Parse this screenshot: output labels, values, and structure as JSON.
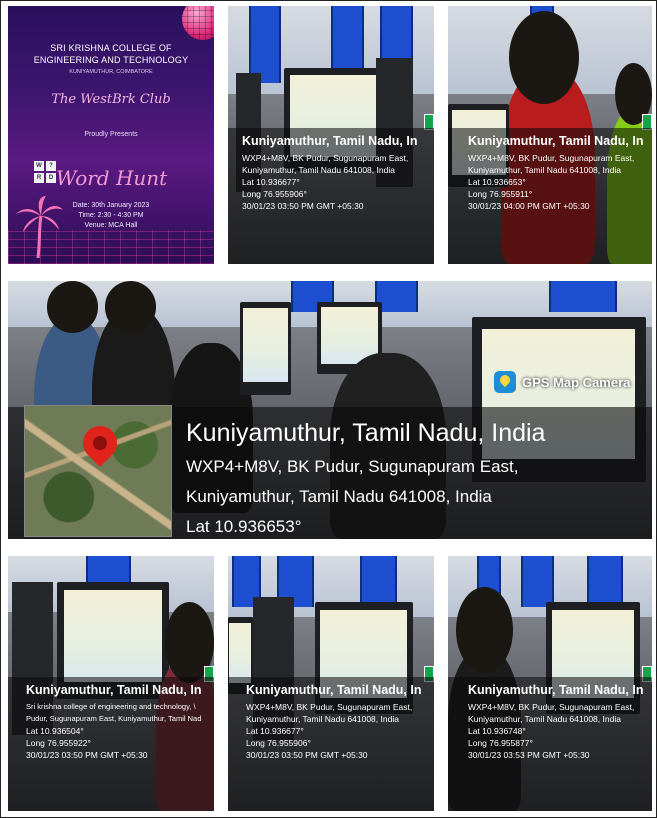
{
  "poster": {
    "college_line1": "SRI KRISHNA COLLEGE OF",
    "college_line2": "ENGINEERING AND TECHNOLOGY",
    "place": "KUNIYAMUTHUR, COIMBATORE",
    "club": "The WestBrk Club",
    "presents": "Proudly Presents",
    "event": "Word Hunt",
    "date": "Date: 30th January 2023",
    "time": "Time: 2:30 - 4:30 PM",
    "venue": "Venue: MCA Hall",
    "grid_letters": [
      "W",
      "?",
      "R",
      "D"
    ]
  },
  "photos": [
    {
      "title": "Kuniyamuthur, Tamil Nadu, In",
      "line1": "WXP4+M8V, BK Pudur, Sugunapuram East,",
      "line2": "Kuniyamuthur, Tamil Nadu 641008, India",
      "lat": "Lat 10.936677°",
      "long": "Long 76.955906°",
      "time": "30/01/23 03:50 PM GMT +05:30"
    },
    {
      "title": "Kuniyamuthur, Tamil Nadu, In",
      "line1": "WXP4+M8V, BK Pudur, Sugunapuram East,",
      "line2": "Kuniyamuthur, Tamil Nadu 641008, India",
      "lat": "Lat 10.936653°",
      "long": "Long 76.955911°",
      "time": "30/01/23 04:00 PM GMT +05:30"
    },
    {
      "title": "Kuniyamuthur, Tamil Nadu, In",
      "line1": "Sri krishna college of engineering and technology, \\",
      "line2": "Pudur, Sugunapuram East, Kuniyamuthur, Tamil Nad",
      "lat": "Lat 10.936504°",
      "long": "Long 76.955922°",
      "time": "30/01/23 03:50 PM GMT +05:30"
    },
    {
      "title": "Kuniyamuthur, Tamil Nadu, In",
      "line1": "WXP4+M8V, BK Pudur, Sugunapuram East,",
      "line2": "Kuniyamuthur, Tamil Nadu 641008, India",
      "lat": "Lat 10.936677°",
      "long": "Long 76.955906°",
      "time": "30/01/23 03:50 PM GMT +05:30"
    },
    {
      "title": "Kuniyamuthur, Tamil Nadu, In",
      "line1": "WXP4+M8V, BK Pudur, Sugunapuram East,",
      "line2": "Kuniyamuthur, Tamil Nadu 641008, India",
      "lat": "Lat 10.936748°",
      "long": "Long 76.955877°",
      "time": "30/01/23 03:53 PM GMT +05:30"
    }
  ],
  "main_photo": {
    "badge": "GPS Map Camera",
    "title": "Kuniyamuthur, Tamil Nadu, India",
    "line1": "WXP4+M8V, BK Pudur, Sugunapuram East,",
    "line2": "Kuniyamuthur, Tamil Nadu 641008, India",
    "lat": "Lat 10.936653°"
  }
}
